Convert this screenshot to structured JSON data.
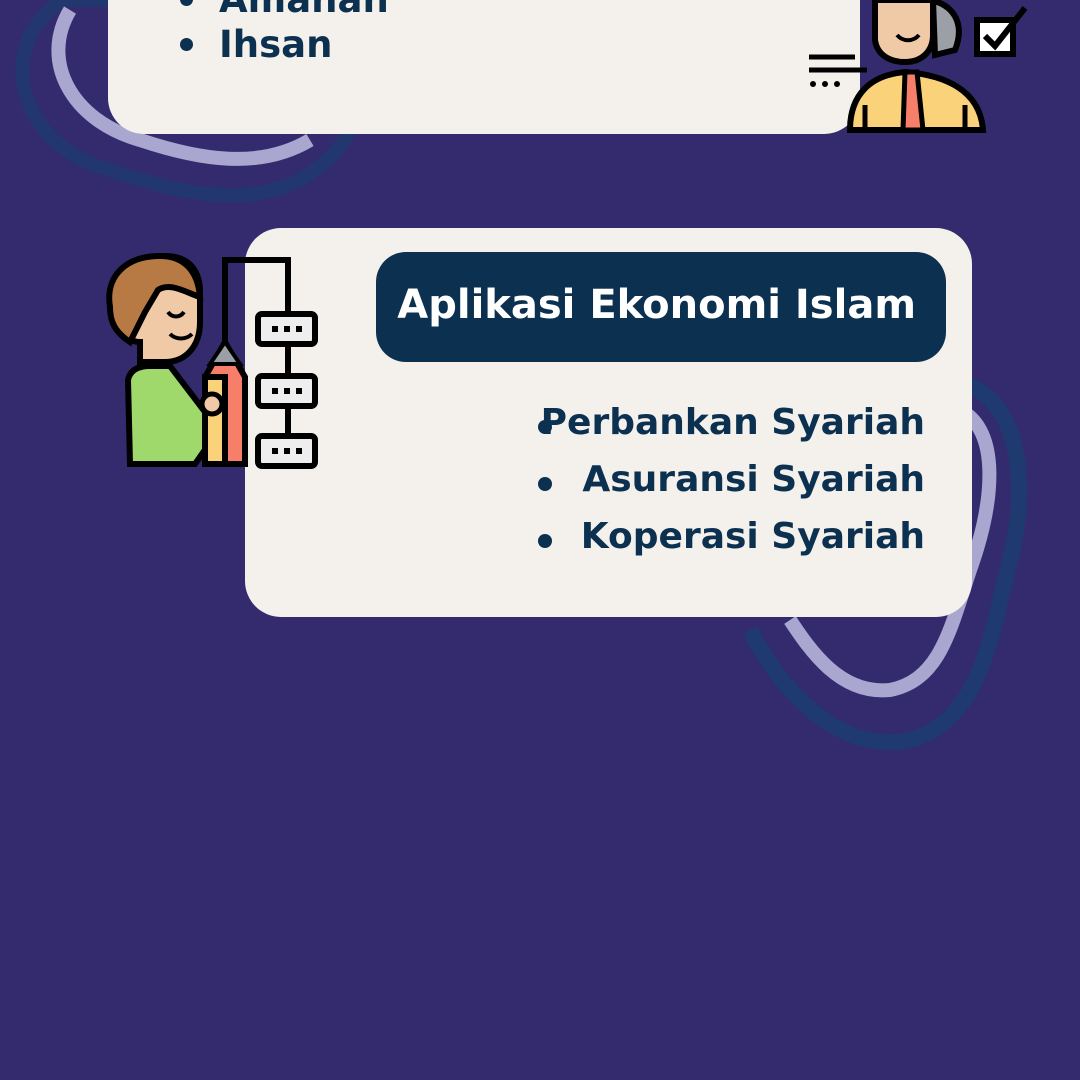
{
  "colors": {
    "background": "#332b6e",
    "card": "#f4f1ec",
    "accent_dark": "#0c3050",
    "blob_light": "#a9a6cf",
    "blob_dark": "#1e3a6e"
  },
  "top_card": {
    "items": [
      "Amanah",
      "Ihsan"
    ]
  },
  "main_card": {
    "title": "Aplikasi Ekonomi Islam",
    "items": [
      "Perbankan Syariah",
      "Asuransi Syariah",
      "Koperasi Syariah"
    ]
  },
  "illustrations": {
    "top_right": "businessman-checklist-icon",
    "left": "man-with-pencil-chart-icon"
  }
}
